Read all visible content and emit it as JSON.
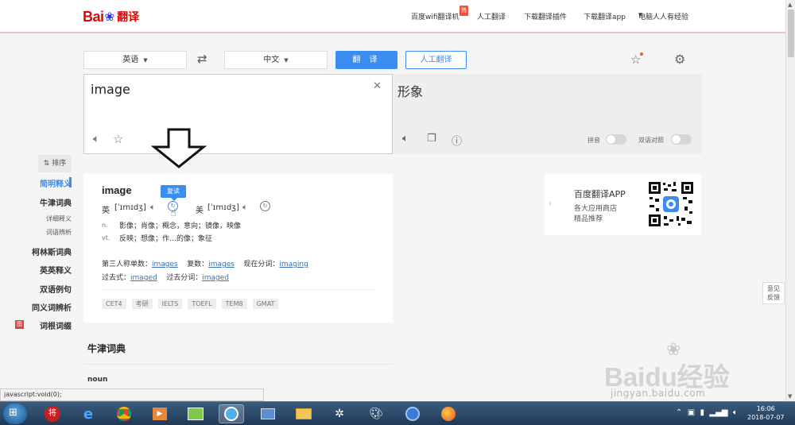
{
  "header": {
    "logo_text_bai": "Bai",
    "logo_text_fy": "翻译",
    "nav": [
      "百度wifi翻译机",
      "人工翻译",
      "下载翻译插件",
      "下载翻译app",
      "电脑人人有经验"
    ],
    "hot_badge": "热"
  },
  "controls": {
    "source_lang": "英语",
    "target_lang": "中文",
    "translate_label": "翻 译",
    "human_label": "人工翻译"
  },
  "input": {
    "text": "image"
  },
  "output": {
    "text": "形象",
    "pinyin_label": "拼音",
    "bilingual_label": "双语对照"
  },
  "sidebar": {
    "sort_label": "⇅ 排序",
    "items": [
      "简明释义",
      "牛津词典",
      "详细释义",
      "词语辨析",
      "柯林斯词典",
      "英英释义",
      "双语例句",
      "同义词辨析",
      "词根词缀"
    ]
  },
  "result": {
    "word": "image",
    "uk_label": "英",
    "uk_phonetic": "[ˈɪmɪdʒ]",
    "us_label": "美",
    "us_phonetic": "[ˈɪmɪdʒ]",
    "tooltip": "复读",
    "senses": [
      {
        "pos": "n.",
        "def": "影像；肖像；概念，意向；镜像，映像"
      },
      {
        "pos": "vt.",
        "def": "反映；想像；作…的像；象征"
      }
    ],
    "forms_row1": {
      "third_label": "第三人称单数：",
      "third": "images",
      "plural_label": "复数：",
      "plural": "images",
      "present_label": "现在分词：",
      "present": "imaging"
    },
    "forms_row2": {
      "past_label": "过去式：",
      "past": "imaged",
      "pp_label": "过去分词：",
      "pp": "imaged"
    },
    "tags": [
      "CET4",
      "考研",
      "IELTS",
      "TOEFL",
      "TEM8",
      "GMAT"
    ]
  },
  "promo": {
    "title": "百度翻译APP",
    "line1": "各大应用商店",
    "line2": "精品推荐"
  },
  "feedback": {
    "line1": "意见",
    "line2": "反馈"
  },
  "oxford": {
    "title": "牛津词典",
    "pos": "noun"
  },
  "status_bar": "javascript:void(0);",
  "watermark": {
    "brand": "Baidu经验",
    "url": "jingyan.baidu.com"
  },
  "taskbar": {
    "time": "16:06",
    "date": "2018-07-07"
  },
  "colors": {
    "accent": "#3b8ef0",
    "brand_red": "#e10602",
    "link": "#3b6fb5"
  }
}
